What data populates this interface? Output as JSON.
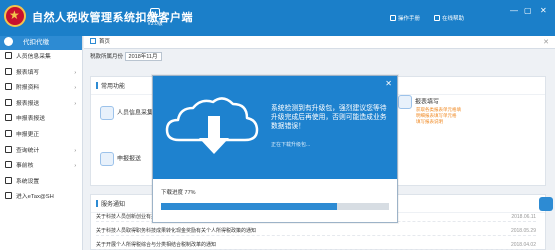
{
  "titlebar": {
    "app_title": "自然人税收管理系统扣缴客户端",
    "version_label": "V3.0版",
    "right_items": [
      "操作手册",
      "在线帮助"
    ],
    "window_controls": [
      "—",
      "▢",
      "✕"
    ]
  },
  "sidebar": {
    "header": "代扣代缴",
    "items": [
      {
        "label": "人员信息采集",
        "icon": "person-icon",
        "caret": ""
      },
      {
        "label": "报表填写",
        "icon": "edit-icon",
        "caret": "›"
      },
      {
        "label": "附报资料",
        "icon": "folder-icon",
        "caret": "›"
      },
      {
        "label": "报表报送",
        "icon": "send-icon",
        "caret": "›"
      },
      {
        "label": "申报表报送",
        "icon": "doc-icon",
        "caret": ""
      },
      {
        "label": "申报更正",
        "icon": "search-icon",
        "caret": ""
      },
      {
        "label": "查询统计",
        "icon": "chart-icon",
        "caret": "›"
      },
      {
        "label": "事前核",
        "icon": "check-icon",
        "caret": "›"
      },
      {
        "label": "系统设置",
        "icon": "gear-icon",
        "caret": ""
      },
      {
        "label": "进入eTax@SH",
        "icon": "link-icon",
        "caret": ""
      }
    ]
  },
  "breadcrumb": {
    "home": "首页",
    "close": "✕"
  },
  "period": {
    "label": "税款所属月份",
    "value": "2018年11月"
  },
  "common_functions": {
    "title": "常用功能",
    "items": [
      {
        "label": "人员信息采集"
      },
      {
        "label": "报表填写",
        "desc_lines": [
          "获取各类报表单元格填",
          "明细报表填写单元格",
          "填写报表说明"
        ]
      },
      {
        "label": "申报报送"
      }
    ]
  },
  "notices": {
    "title": "服务通知",
    "rows": [
      {
        "text": "关于科技人员创新创业有关个人所得税问题的公告",
        "date": "2018.06.11"
      },
      {
        "text": "关于科技人员取得职务科技成果转化现金奖励有关个人所得税政策的通知",
        "date": "2018.05.29"
      },
      {
        "text": "关于开展个人所得税综合与分类相结合税制改革的通知",
        "date": "2018.04.02"
      }
    ]
  },
  "modal": {
    "message": "系统检测到有升级包，强烈建议您等待升级完成后再使用，否则可能造成业务数据错误！",
    "sub_message": "正在下载升级包...",
    "progress_label": "下载进度 77%",
    "progress_value": 0.77,
    "close": "✕"
  },
  "colors": {
    "brand_blue": "#1b7fc9",
    "accent_orange": "#f08a24"
  }
}
